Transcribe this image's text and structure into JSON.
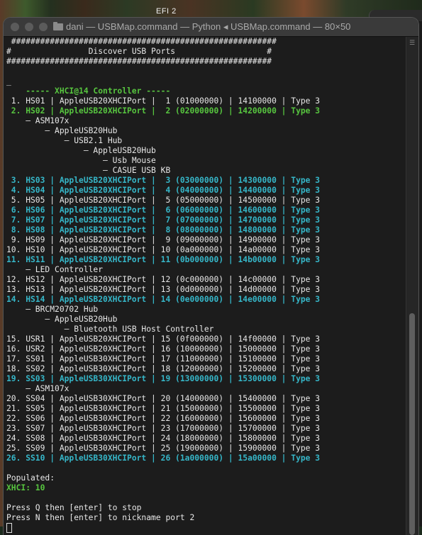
{
  "desktop": {
    "title": "EFI 2"
  },
  "window": {
    "title": "dani — USBMap.command — Python ◂ USBMap.command — 80×50"
  },
  "terminal": {
    "lines": [
      {
        "text": " #######################################################",
        "cls": ""
      },
      {
        "text": "#                Discover USB Ports                   #",
        "cls": ""
      },
      {
        "text": "#######################################################",
        "cls": ""
      },
      {
        "text": "",
        "cls": ""
      },
      {
        "text": "_",
        "cls": ""
      },
      {
        "text": "    ----- XHCI@14 Controller -----",
        "cls": "g"
      },
      {
        "text": " 1. HS01 | AppleUSB20XHCIPort |  1 (01000000) | 14100000 | Type 3",
        "cls": ""
      },
      {
        "text": " 2. HS02 | AppleUSB20XHCIPort |  2 (02000000) | 14200000 | Type 3",
        "cls": "g"
      },
      {
        "text": "    – ASM107x",
        "cls": ""
      },
      {
        "text": "        – AppleUSB20Hub",
        "cls": ""
      },
      {
        "text": "            – USB2.1 Hub",
        "cls": ""
      },
      {
        "text": "                – AppleUSB20Hub",
        "cls": ""
      },
      {
        "text": "                    – Usb Mouse",
        "cls": ""
      },
      {
        "text": "                    – CASUE USB KB",
        "cls": ""
      },
      {
        "text": " 3. HS03 | AppleUSB20XHCIPort |  3 (03000000) | 14300000 | Type 3",
        "cls": "c"
      },
      {
        "text": " 4. HS04 | AppleUSB20XHCIPort |  4 (04000000) | 14400000 | Type 3",
        "cls": "c"
      },
      {
        "text": " 5. HS05 | AppleUSB20XHCIPort |  5 (05000000) | 14500000 | Type 3",
        "cls": ""
      },
      {
        "text": " 6. HS06 | AppleUSB20XHCIPort |  6 (06000000) | 14600000 | Type 3",
        "cls": "c"
      },
      {
        "text": " 7. HS07 | AppleUSB20XHCIPort |  7 (07000000) | 14700000 | Type 3",
        "cls": "c"
      },
      {
        "text": " 8. HS08 | AppleUSB20XHCIPort |  8 (08000000) | 14800000 | Type 3",
        "cls": "c"
      },
      {
        "text": " 9. HS09 | AppleUSB20XHCIPort |  9 (09000000) | 14900000 | Type 3",
        "cls": ""
      },
      {
        "text": "10. HS10 | AppleUSB20XHCIPort | 10 (0a000000) | 14a00000 | Type 3",
        "cls": ""
      },
      {
        "text": "11. HS11 | AppleUSB20XHCIPort | 11 (0b000000) | 14b00000 | Type 3",
        "cls": "c"
      },
      {
        "text": "    – LED Controller",
        "cls": ""
      },
      {
        "text": "12. HS12 | AppleUSB20XHCIPort | 12 (0c000000) | 14c00000 | Type 3",
        "cls": ""
      },
      {
        "text": "13. HS13 | AppleUSB20XHCIPort | 13 (0d000000) | 14d00000 | Type 3",
        "cls": ""
      },
      {
        "text": "14. HS14 | AppleUSB20XHCIPort | 14 (0e000000) | 14e00000 | Type 3",
        "cls": "c"
      },
      {
        "text": "    – BRCM20702 Hub",
        "cls": ""
      },
      {
        "text": "        – AppleUSB20Hub",
        "cls": ""
      },
      {
        "text": "            – Bluetooth USB Host Controller",
        "cls": ""
      },
      {
        "text": "15. USR1 | AppleUSB20XHCIPort | 15 (0f000000) | 14f00000 | Type 3",
        "cls": ""
      },
      {
        "text": "16. USR2 | AppleUSB20XHCIPort | 16 (10000000) | 15000000 | Type 3",
        "cls": ""
      },
      {
        "text": "17. SS01 | AppleUSB30XHCIPort | 17 (11000000) | 15100000 | Type 3",
        "cls": ""
      },
      {
        "text": "18. SS02 | AppleUSB30XHCIPort | 18 (12000000) | 15200000 | Type 3",
        "cls": ""
      },
      {
        "text": "19. SS03 | AppleUSB30XHCIPort | 19 (13000000) | 15300000 | Type 3",
        "cls": "c"
      },
      {
        "text": "    – ASM107x",
        "cls": ""
      },
      {
        "text": "20. SS04 | AppleUSB30XHCIPort | 20 (14000000) | 15400000 | Type 3",
        "cls": ""
      },
      {
        "text": "21. SS05 | AppleUSB30XHCIPort | 21 (15000000) | 15500000 | Type 3",
        "cls": ""
      },
      {
        "text": "22. SS06 | AppleUSB30XHCIPort | 22 (16000000) | 15600000 | Type 3",
        "cls": ""
      },
      {
        "text": "23. SS07 | AppleUSB30XHCIPort | 23 (17000000) | 15700000 | Type 3",
        "cls": ""
      },
      {
        "text": "24. SS08 | AppleUSB30XHCIPort | 24 (18000000) | 15800000 | Type 3",
        "cls": ""
      },
      {
        "text": "25. SS09 | AppleUSB30XHCIPort | 25 (19000000) | 15900000 | Type 3",
        "cls": ""
      },
      {
        "text": "26. SS10 | AppleUSB30XHCIPort | 26 (1a000000) | 15a00000 | Type 3",
        "cls": "c"
      },
      {
        "text": "",
        "cls": ""
      },
      {
        "text": "Populated:",
        "cls": ""
      },
      {
        "text": "XHCI: 10",
        "cls": "g"
      },
      {
        "text": "",
        "cls": ""
      },
      {
        "text": "Press Q then [enter] to stop",
        "cls": ""
      },
      {
        "text": "Press N then [enter] to nickname port 2",
        "cls": ""
      }
    ]
  },
  "colors": {
    "green": "#57c53f",
    "cyan": "#36b7c9",
    "text": "#e8e8e8",
    "background": "#1c1c1c"
  }
}
